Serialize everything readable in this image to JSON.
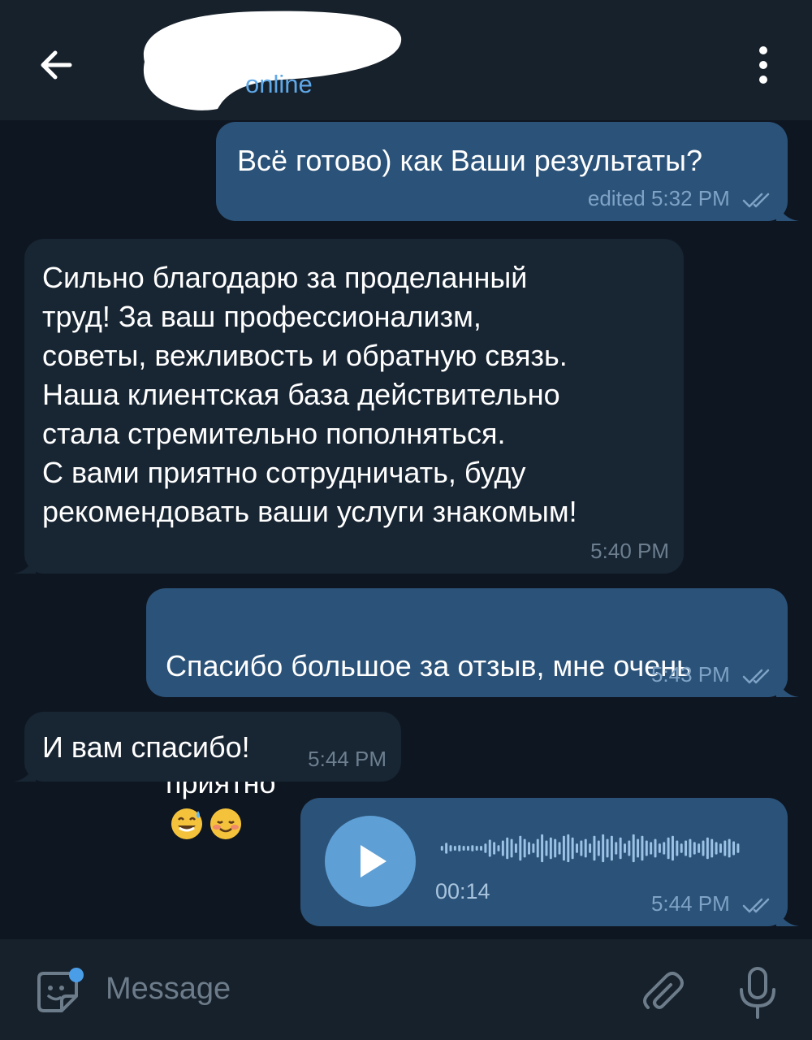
{
  "header": {
    "status": "online"
  },
  "messages": [
    {
      "text": "Всё готово) как Ваши результаты?",
      "meta": "edited 5:32 PM"
    },
    {
      "text": "Сильно благодарю за проделанный\nтруд! За ваш профессионализм,\nсоветы, вежливость и обратную связь.\nНаша клиентская база действительно\nстала стремительно пополняться.\nС вами приятно сотрудничать, буду\nрекомендовать ваши услуги знакомым!",
      "meta": "5:40 PM"
    },
    {
      "text_line1": "Спасибо большое за отзыв, мне очень",
      "text_line2": "приятно",
      "emojis": [
        "grinning-sweat-icon",
        "smiling-blush-icon"
      ],
      "meta": "5:43 PM"
    },
    {
      "text": "И вам спасибо!",
      "meta": "5:44 PM"
    },
    {
      "type": "voice",
      "duration": "00:14",
      "meta": "5:44 PM",
      "waveform": [
        0.15,
        0.35,
        0.2,
        0.15,
        0.2,
        0.15,
        0.15,
        0.2,
        0.15,
        0.15,
        0.3,
        0.55,
        0.4,
        0.2,
        0.5,
        0.7,
        0.6,
        0.3,
        0.8,
        0.6,
        0.4,
        0.3,
        0.6,
        0.9,
        0.5,
        0.7,
        0.6,
        0.4,
        0.8,
        0.9,
        0.7,
        0.3,
        0.5,
        0.6,
        0.3,
        0.8,
        0.5,
        0.9,
        0.6,
        0.8,
        0.4,
        0.7,
        0.3,
        0.5,
        0.9,
        0.6,
        0.8,
        0.5,
        0.4,
        0.6,
        0.3,
        0.4,
        0.7,
        0.8,
        0.5,
        0.3,
        0.5,
        0.6,
        0.4,
        0.3,
        0.5,
        0.7,
        0.6,
        0.4,
        0.3,
        0.5,
        0.6,
        0.45,
        0.3
      ]
    }
  ],
  "input": {
    "placeholder": "Message"
  },
  "colors": {
    "background": "#0e1621",
    "header": "#17212b",
    "outgoing_bubble": "#2b5278",
    "incoming_bubble": "#182533",
    "accent": "#5fa8e8",
    "play_button": "#5e9fd6"
  }
}
